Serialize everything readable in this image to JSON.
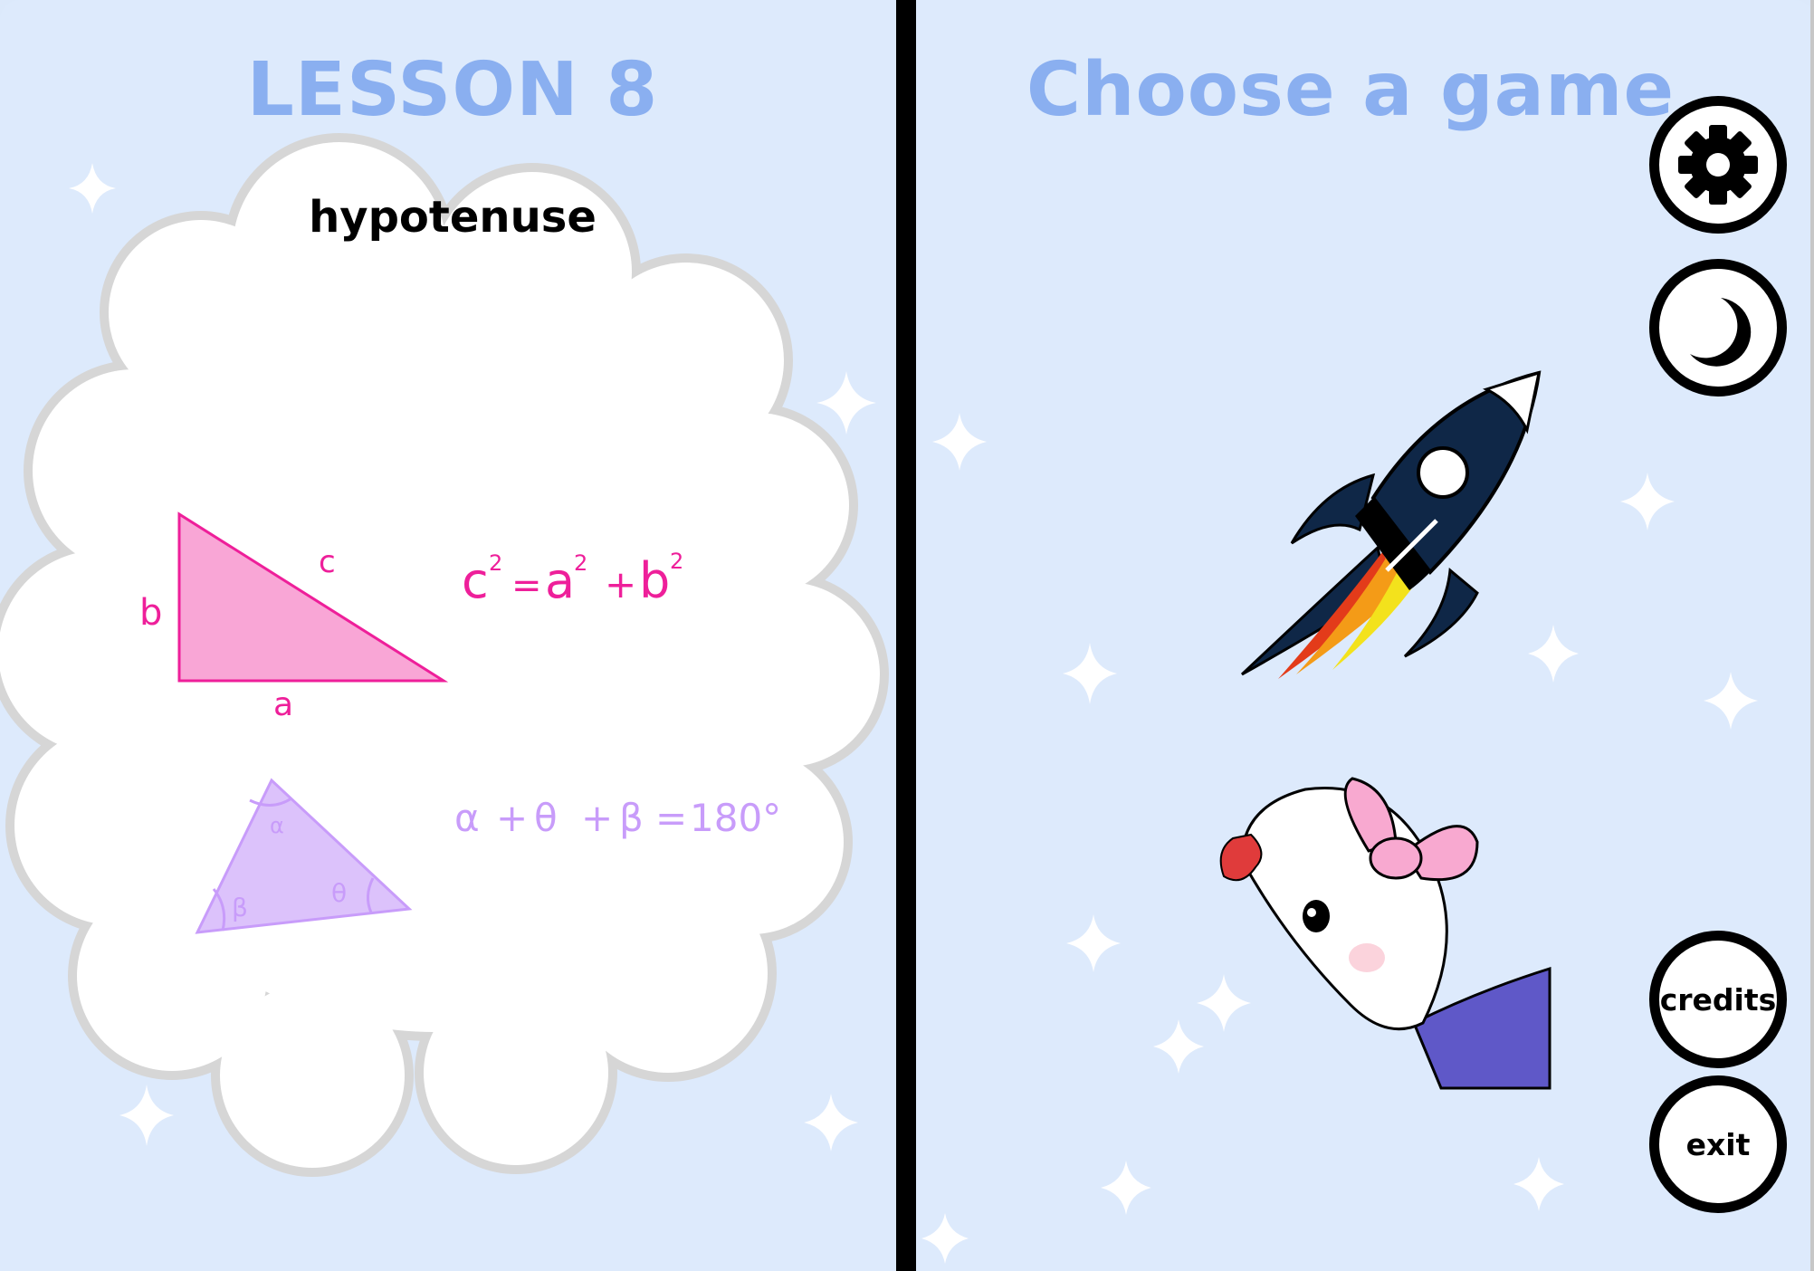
{
  "lesson": {
    "title": "LESSON 8",
    "word": "hypotenuse",
    "triangle_labels": {
      "side_a": "a",
      "side_b": "b",
      "side_c": "c"
    },
    "pythagoras": {
      "lhs": "c",
      "a": "a",
      "b": "b",
      "exp": "2",
      "eq": "=",
      "plus": "+"
    },
    "angle_labels": {
      "alpha": "α",
      "beta": "β",
      "theta": "θ"
    },
    "angle_sum": {
      "plus": "+",
      "eq": "=",
      "value": "180°"
    }
  },
  "games": {
    "title": "Choose a game",
    "items": [
      {
        "icon": "rocket-icon"
      },
      {
        "icon": "sock-puppet-icon"
      }
    ]
  },
  "buttons": {
    "settings": "gear-icon",
    "theme": "moon-icon",
    "credits": "credits",
    "exit": "exit"
  },
  "colors": {
    "background": "#ddeafc",
    "title": "#8aaff0",
    "formula_pink": "#ee1f9a",
    "triangle_pink": "#f9a6d6",
    "triangle_lilac": "#dcc2fb",
    "formula_lilac": "#c89cfa",
    "rocket_body": "#0f2747",
    "sock_sleeve": "#5f58c8"
  }
}
